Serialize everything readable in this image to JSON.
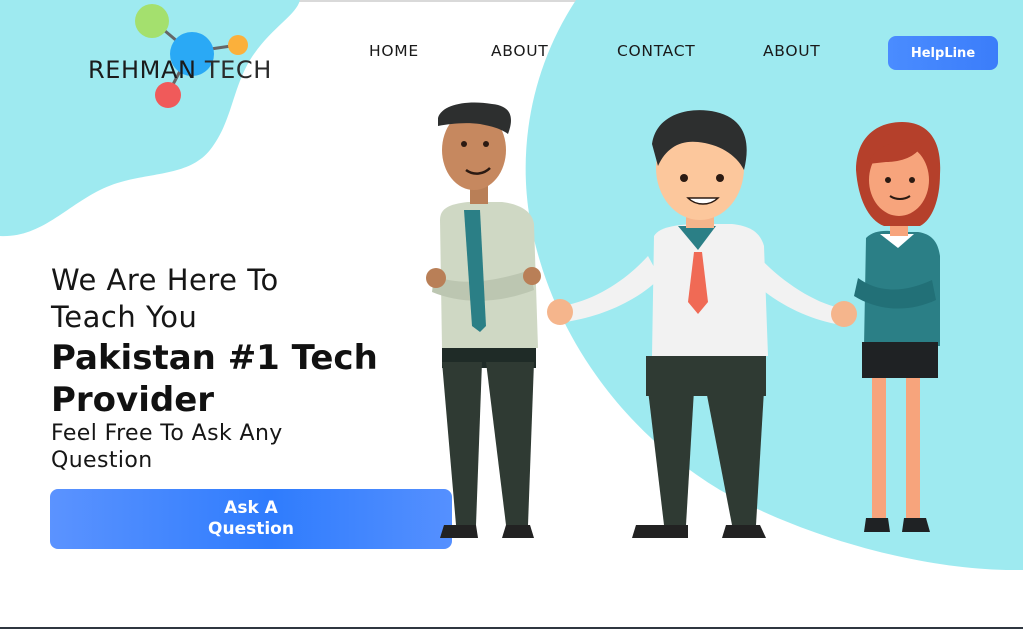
{
  "brand": {
    "name_part1": "REHMAN",
    "name_part2": "TECH",
    "colors": {
      "green": "#a4e06e",
      "blue": "#2aa9f5",
      "orange": "#fbb03b",
      "red": "#f05a5a"
    }
  },
  "nav": {
    "items": [
      {
        "label": "HOME"
      },
      {
        "label": "ABOUT"
      },
      {
        "label": "CONTACT"
      },
      {
        "label": "ABOUT"
      }
    ],
    "helpline_label": "HelpLine"
  },
  "hero": {
    "line1": "We Are Here To",
    "line2": "Teach You",
    "headline1": "Pakistan #1 Tech",
    "headline2": "Provider",
    "sub1": "Feel Free To Ask Any",
    "sub2": "Question",
    "cta_label": "Ask A Question"
  },
  "theme": {
    "accent_blue": "#3b7dfa",
    "bg_cyan": "#9eeaf0"
  },
  "illustration": {
    "icon": "three-people-illustration"
  }
}
